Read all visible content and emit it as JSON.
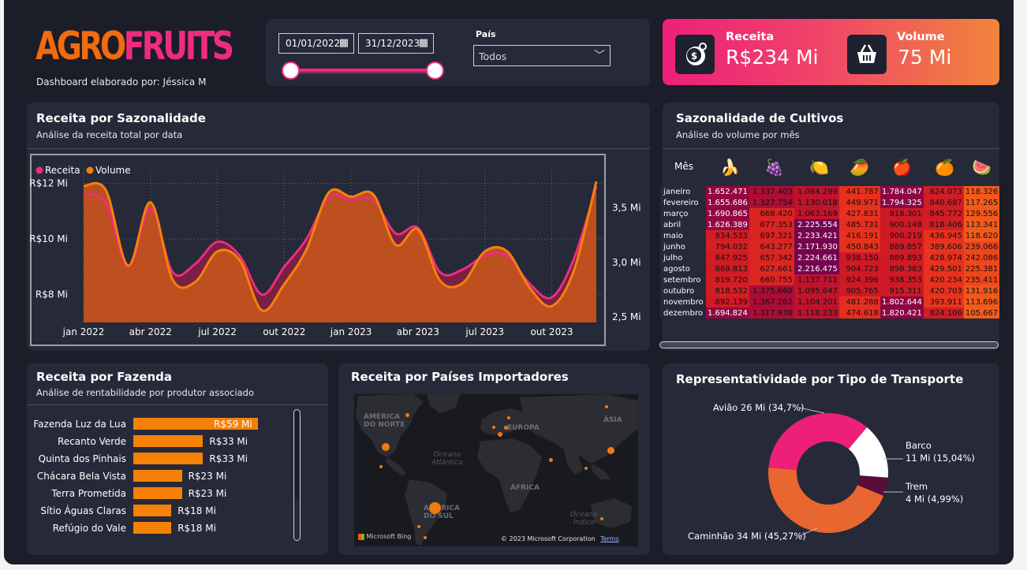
{
  "header": {
    "logo_part1": "AGRO",
    "logo_part2": "FRUITS",
    "byline": "Dashboard elaborado por: Jéssica M"
  },
  "filters": {
    "date_start": "01/01/2022",
    "date_end": "31/12/2023",
    "country_label": "País",
    "country_value": "Todos",
    "calendar_icon": "calendar-icon",
    "chevron_icon": "chevron-down-icon"
  },
  "kpis": {
    "receita_label": "Receita",
    "receita_value": "R$234 Mi",
    "volume_label": "Volume",
    "volume_value": "75 Mi",
    "receita_icon": "money-bag-icon",
    "volume_icon": "shopping-basket-icon"
  },
  "colors": {
    "pink": "#ee2c7e",
    "orange": "#f68109",
    "background": "#1b1d28",
    "card": "#262938"
  },
  "seasonality_chart": {
    "title": "Receita por Sazonalidade",
    "subtitle": "Análise da receita total por data",
    "legend": [
      "Receita",
      "Volume"
    ],
    "left_ticks": [
      "R$12 Mi",
      "R$10 Mi",
      "R$8 Mi"
    ],
    "right_ticks": [
      "3,5 Mi",
      "3,0 Mi",
      "2,5 Mi"
    ],
    "x_ticks": [
      "jan 2022",
      "abr 2022",
      "jul 2022",
      "out 2022",
      "jan 2023",
      "abr 2023",
      "jul 2023",
      "out 2023"
    ]
  },
  "chart_data": [
    {
      "type": "area",
      "title": "Receita por Sazonalidade",
      "x": [
        "jan 2022",
        "fev 2022",
        "mar 2022",
        "abr 2022",
        "mai 2022",
        "jun 2022",
        "jul 2022",
        "ago 2022",
        "set 2022",
        "out 2022",
        "nov 2022",
        "dez 2022",
        "jan 2023",
        "fev 2023",
        "mar 2023",
        "abr 2023",
        "mai 2023",
        "jun 2023",
        "jul 2023",
        "ago 2023",
        "set 2023",
        "out 2023",
        "nov 2023",
        "dez 2023"
      ],
      "series": [
        {
          "name": "Receita",
          "axis": "left",
          "values": [
            11.6,
            11.3,
            9.0,
            11.1,
            8.8,
            9.1,
            9.9,
            9.4,
            8.0,
            9.0,
            10.0,
            11.5,
            11.4,
            11.4,
            10.2,
            10.4,
            8.8,
            8.9,
            9.4,
            9.4,
            8.4,
            7.9,
            9.3,
            11.9
          ]
        },
        {
          "name": "Volume",
          "axis": "right",
          "values": [
            3.7,
            3.66,
            2.97,
            3.55,
            2.84,
            2.82,
            3.1,
            3.02,
            2.56,
            2.8,
            3.12,
            3.64,
            3.6,
            3.62,
            3.16,
            3.3,
            2.83,
            2.81,
            3.1,
            3.1,
            2.77,
            2.6,
            2.93,
            3.74
          ]
        }
      ],
      "ylim_left": [
        7.0,
        12.5
      ],
      "ylim_right": [
        2.45,
        3.85
      ],
      "legend_position": "top-left"
    },
    {
      "type": "heatmap",
      "title": "Sazonalidade de Cultivos",
      "subtitle": "Análise do volume por mês",
      "row_header": "Mês",
      "columns": [
        "banana",
        "uva",
        "limão",
        "manga",
        "maçã",
        "laranja",
        "melancia"
      ],
      "column_icons": [
        "🍌",
        "🍇",
        "🍋",
        "🥭",
        "🍎",
        "🍊",
        "🍉"
      ],
      "rows": [
        "janeiro",
        "fevereiro",
        "março",
        "abril",
        "maio",
        "junho",
        "julho",
        "agosto",
        "setembro",
        "outubro",
        "novembro",
        "dezembro"
      ],
      "values": [
        [
          "1.652.471",
          "1.337.403",
          "1.084.299",
          "441.787",
          "1.784.047",
          "824.073",
          "118.326"
        ],
        [
          "1.655.686",
          "1.327.754",
          "1.130.018",
          "449.971",
          "1.794.325",
          "840.687",
          "117.265"
        ],
        [
          "1.690.865",
          "668.420",
          "1.063.169",
          "427.831",
          "918.301",
          "845.772",
          "129.556"
        ],
        [
          "1.626.389",
          "677.353",
          "2.225.554",
          "485.731",
          "900.148",
          "818.406",
          "113.341"
        ],
        [
          "834.533",
          "697.321",
          "2.233.421",
          "416.191",
          "900.219",
          "436.945",
          "118.620"
        ],
        [
          "794.032",
          "643.277",
          "2.171.930",
          "450.843",
          "889.857",
          "389.606",
          "239.066"
        ],
        [
          "847.925",
          "657.342",
          "2.224.661",
          "938.150",
          "889.893",
          "428.974",
          "242.086"
        ],
        [
          "869.813",
          "627.661",
          "2.216.475",
          "904.723",
          "898.383",
          "429.501",
          "225.381"
        ],
        [
          "819.720",
          "660.755",
          "1.137.711",
          "924.396",
          "938.353",
          "420.234",
          "235.411"
        ],
        [
          "818.532",
          "1.375.660",
          "1.095.647",
          "905.765",
          "915.311",
          "420.703",
          "131.916"
        ],
        [
          "892.139",
          "1.367.262",
          "1.104.201",
          "481.288",
          "1.802.644",
          "393.911",
          "113.696"
        ],
        [
          "1.694.824",
          "1.317.938",
          "1.118.233",
          "474.618",
          "1.820.421",
          "824.106",
          "105.667"
        ]
      ]
    },
    {
      "type": "bar",
      "title": "Receita por Fazenda",
      "subtitle": "Análise de rentabilidade por produtor associado",
      "categories": [
        "Fazenda Luz da Lua",
        "Recanto Verde",
        "Quinta dos Pinhais",
        "Chácara Bela Vista",
        "Terra Prometida",
        "Sítio Águas Claras",
        "Refúgio do Vale"
      ],
      "values": [
        59,
        33,
        33,
        23,
        23,
        18,
        18
      ],
      "labels": [
        "R$59 Mi",
        "R$33 Mi",
        "R$33 Mi",
        "R$23 Mi",
        "R$23 Mi",
        "R$18 Mi",
        "R$18 Mi"
      ],
      "orientation": "horizontal"
    },
    {
      "type": "pie",
      "title": "Representatividade por Tipo de Transporte",
      "donut": true,
      "categories": [
        "Caminhão",
        "Avião",
        "Barco",
        "Trem"
      ],
      "values": [
        45.27,
        34.7,
        15.04,
        4.99
      ],
      "labels": [
        "Caminhão 34 Mi (45,27%)",
        "Avião 26 Mi (34,7%)",
        "Barco",
        "Trem"
      ],
      "sublabels": [
        "",
        "",
        "11 Mi (15,04%)",
        "4 Mi (4,99%)"
      ],
      "colors": [
        "#e8662f",
        "#ed1f79",
        "#ffffff",
        "#5a0d3a"
      ]
    }
  ],
  "map_card": {
    "title": "Receita por Países Importadores",
    "labels": [
      "AMÉRICA\nDO NORTE",
      "EUROPA",
      "ÁSIA",
      "ÁFRICA",
      "AMÉRICA\nDO SUL"
    ],
    "oceans": [
      "Oceano\nAtlântico",
      "Oceano\nÍndico"
    ],
    "bing_label": "Microsoft Bing",
    "copyright": "© 2023 Microsoft Corporation",
    "terms": "Terms"
  }
}
